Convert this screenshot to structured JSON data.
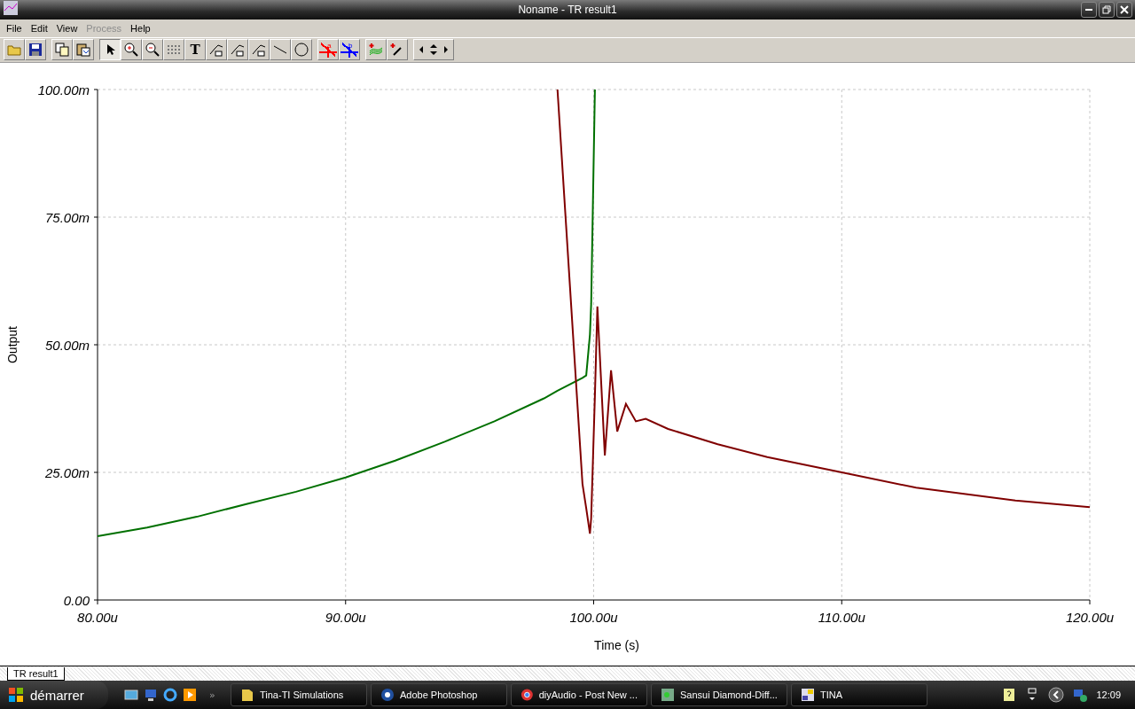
{
  "window": {
    "title": "Noname - TR result1"
  },
  "menu": [
    {
      "label": "File",
      "disabled": false
    },
    {
      "label": "Edit",
      "disabled": false
    },
    {
      "label": "View",
      "disabled": false
    },
    {
      "label": "Process",
      "disabled": true
    },
    {
      "label": "Help",
      "disabled": false
    }
  ],
  "toolbar": [
    [
      {
        "kind": "open",
        "selected": false
      },
      {
        "kind": "save",
        "selected": false
      }
    ],
    [
      {
        "kind": "copy",
        "selected": false
      },
      {
        "kind": "paste",
        "selected": false
      }
    ],
    [
      {
        "kind": "pointer",
        "selected": true
      },
      {
        "kind": "zoom-in",
        "selected": false
      },
      {
        "kind": "zoom-out",
        "selected": false
      },
      {
        "kind": "grid",
        "selected": false
      },
      {
        "kind": "text",
        "selected": false,
        "label": "T"
      },
      {
        "kind": "curve-a",
        "selected": false
      },
      {
        "kind": "curve-b",
        "selected": false
      },
      {
        "kind": "curve-c",
        "selected": false
      },
      {
        "kind": "line",
        "selected": false
      },
      {
        "kind": "circle",
        "selected": false
      }
    ],
    [
      {
        "kind": "cursor",
        "selected": false,
        "label": "a",
        "color": "#ff0000"
      },
      {
        "kind": "cursor",
        "selected": false,
        "label": "b",
        "color": "#0000ff"
      }
    ],
    [
      {
        "kind": "add-curves",
        "selected": false
      },
      {
        "kind": "picker",
        "selected": false
      }
    ],
    [
      {
        "kind": "arrows",
        "selected": false
      }
    ]
  ],
  "plot": {
    "chart_data": {
      "type": "line",
      "xlabel": "Time (s)",
      "ylabel": "Output",
      "x": [
        80,
        82,
        84,
        86,
        88,
        90,
        92,
        94,
        96,
        98,
        98.54,
        99.55,
        99.7,
        99.85,
        99.9,
        100.05,
        100.15,
        100.45,
        100.7,
        100.95,
        101.3,
        101.7,
        102.1,
        103,
        105,
        107,
        110,
        113,
        117,
        120
      ],
      "series": [
        {
          "color": "#007000",
          "values": [
            12.5,
            14.2,
            16.3,
            18.8,
            21.2,
            24,
            27.3,
            31,
            35,
            39.5,
            41,
            43.5,
            44,
            52,
            58,
            100,
            null,
            null,
            null,
            null,
            null,
            null,
            null,
            null,
            null,
            null,
            null,
            null,
            null,
            null
          ]
        },
        {
          "color": "#800000",
          "values": [
            null,
            null,
            null,
            null,
            null,
            null,
            null,
            null,
            null,
            null,
            100,
            22.7,
            18,
            13,
            16,
            40,
            57.5,
            28.3,
            45,
            33,
            38.4,
            35,
            35.5,
            33.5,
            30.5,
            28,
            25,
            22,
            19.5,
            18.2
          ]
        }
      ],
      "grid": true,
      "xlim": [
        80,
        120
      ],
      "ylim": [
        0,
        100
      ],
      "xticks": [
        {
          "value": 80,
          "label": "80.00u"
        },
        {
          "value": 90,
          "label": "90.00u"
        },
        {
          "value": 100,
          "label": "100.00u"
        },
        {
          "value": 110,
          "label": "110.00u"
        },
        {
          "value": 120,
          "label": "120.00u"
        }
      ],
      "yticks": [
        {
          "value": 0,
          "label": "0.00"
        },
        {
          "value": 25,
          "label": "25.00m"
        },
        {
          "value": 50,
          "label": "50.00m"
        },
        {
          "value": 75,
          "label": "75.00m"
        },
        {
          "value": 100,
          "label": "100.00m"
        }
      ]
    }
  },
  "tabs": [
    {
      "label": "TR result1",
      "selected": true
    }
  ],
  "taskbar": {
    "start": "démarrer",
    "more": "»",
    "tasks": [
      {
        "label": "Tina-TI Simulations",
        "kind": "folder"
      },
      {
        "label": "Adobe Photoshop",
        "kind": "photoshop"
      },
      {
        "label": "diyAudio - Post New ...",
        "kind": "browser"
      },
      {
        "label": "Sansui Diamond-Diff...",
        "kind": "image"
      },
      {
        "label": "TINA",
        "kind": "tina"
      }
    ],
    "clock": "12:09"
  }
}
